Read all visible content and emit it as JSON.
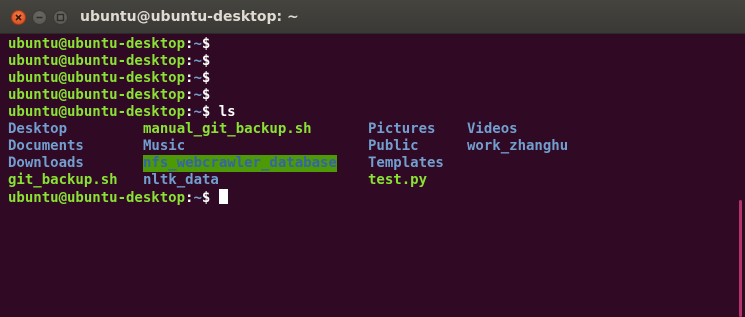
{
  "window": {
    "title": "ubuntu@ubuntu-desktop: ~"
  },
  "terminal": {
    "prompt_user_host": "ubuntu@ubuntu-desktop",
    "prompt_sep": ":",
    "prompt_path": "~",
    "prompt_dollar": "$",
    "command_ls": " ls",
    "listing": [
      [
        "Desktop",
        "manual_git_backup.sh",
        "Pictures",
        "Videos"
      ],
      [
        "Documents",
        "Music",
        "Public",
        "work_zhanghu"
      ],
      [
        "Downloads",
        "nfs_webcrawler_database",
        "Templates",
        ""
      ],
      [
        "git_backup.sh",
        "nltk_data",
        "test.py",
        ""
      ]
    ]
  },
  "colors": {
    "background": "#300a24",
    "prompt": "#8ae234",
    "directory": "#729fcf",
    "highlight_bg": "#4e9a06",
    "scroll_thumb": "#b3346a"
  },
  "icons": {
    "close": "close-icon",
    "minimize": "minimize-icon",
    "maximize": "maximize-icon"
  }
}
